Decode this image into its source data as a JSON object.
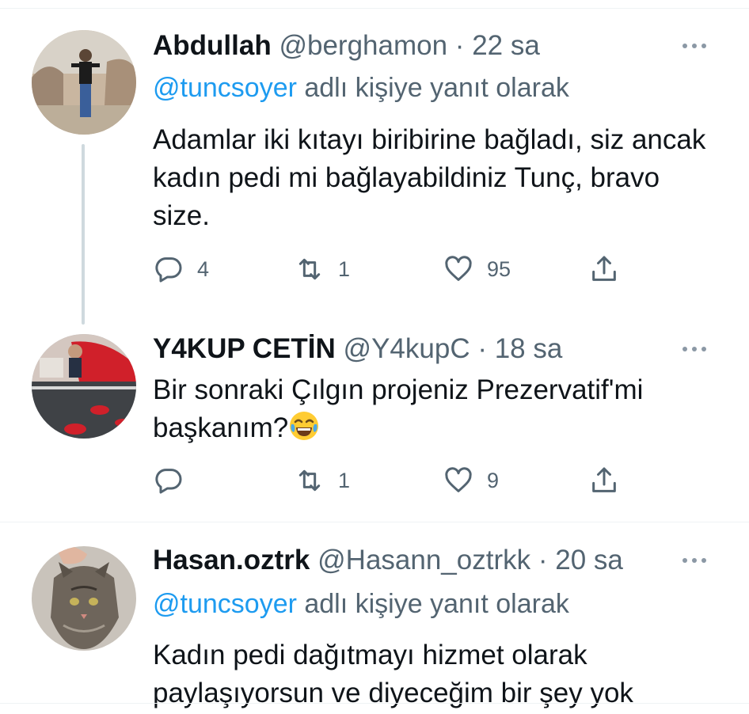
{
  "tweets": [
    {
      "name": "Abdullah",
      "handle": "@berghamon",
      "separator": "·",
      "time": "22 sa",
      "replying_mention": "@tuncsoyer",
      "replying_suffix": " adlı kişiye yanıt olarak",
      "text": "Adamlar iki kıtayı biribirine bağladı, siz ancak kadın pedi mi bağlayabildiniz Tunç, bravo size.",
      "replies": "4",
      "retweets": "1",
      "likes": "95"
    },
    {
      "name": "Y4KUP CETİN",
      "handle": "@Y4kupC",
      "separator": "·",
      "time": "18 sa",
      "text": "Bir sonraki Çılgın projeniz Prezervatif'mi başkanım?",
      "replies": "",
      "retweets": "1",
      "likes": "9"
    },
    {
      "name": "Hasan.oztrk",
      "handle": "@Hasann_oztrkk",
      "separator": "·",
      "time": "20 sa",
      "replying_mention": "@tuncsoyer",
      "replying_suffix": " adlı kişiye yanıt olarak",
      "text": "Kadın pedi dağıtmayı hizmet olarak paylaşıyorsun ve diyeceğim bir şey yok"
    }
  ],
  "icons": {
    "reply": "reply-icon",
    "retweet": "retweet-icon",
    "like": "heart-icon",
    "share": "share-icon",
    "more": "more-icon",
    "emoji": "joy-emoji"
  },
  "colors": {
    "link": "#1d9bf0",
    "secondary_text": "#536471",
    "primary_text": "#0f1419",
    "thread_line": "#cfd9de"
  }
}
